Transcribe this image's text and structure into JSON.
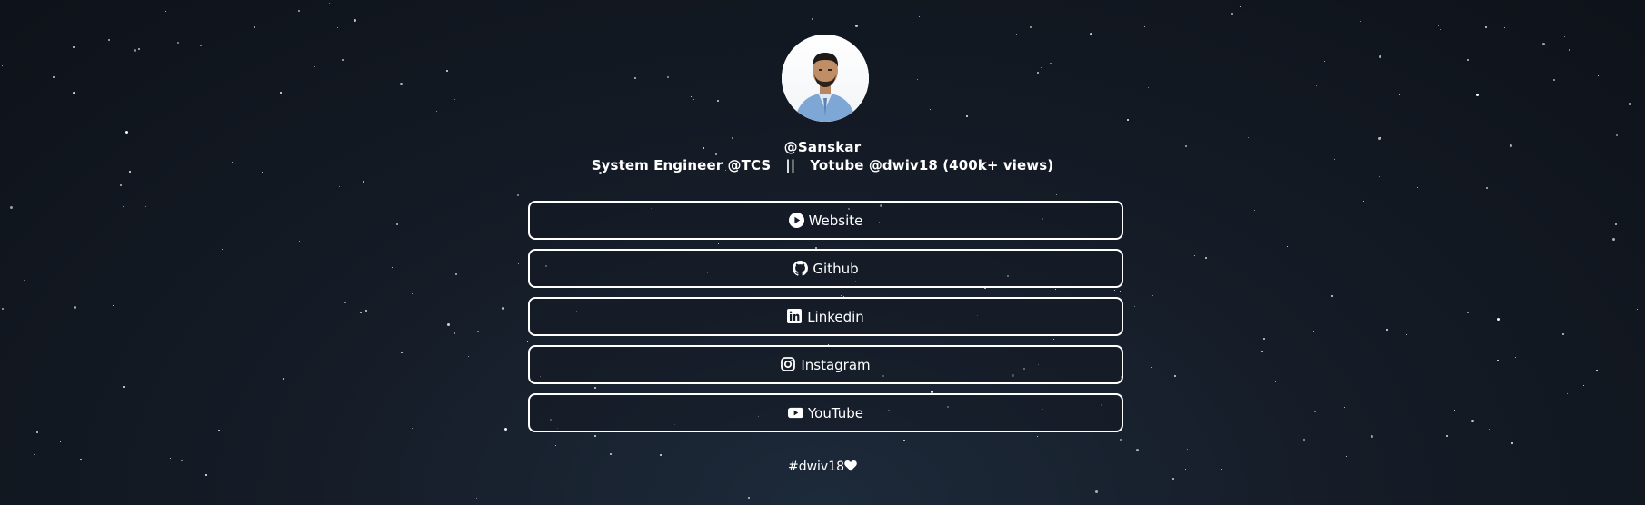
{
  "profile": {
    "handle": "@Sanskar",
    "bio": "System Engineer @TCS   ||   Yotube @dwiv18 (400k+ views)",
    "avatar_icon": "avatar-photo"
  },
  "links": [
    {
      "label": "Website",
      "icon": "play-circle-icon"
    },
    {
      "label": "Github",
      "icon": "github-icon"
    },
    {
      "label": "Linkedin",
      "icon": "linkedin-icon"
    },
    {
      "label": "Instagram",
      "icon": "instagram-icon"
    },
    {
      "label": "YouTube",
      "icon": "youtube-icon"
    }
  ],
  "footer": {
    "tag": "#dwiv18",
    "icon": "heart-icon"
  },
  "colors": {
    "background": "#151c27",
    "text": "#ffffff",
    "border": "#ffffff"
  }
}
